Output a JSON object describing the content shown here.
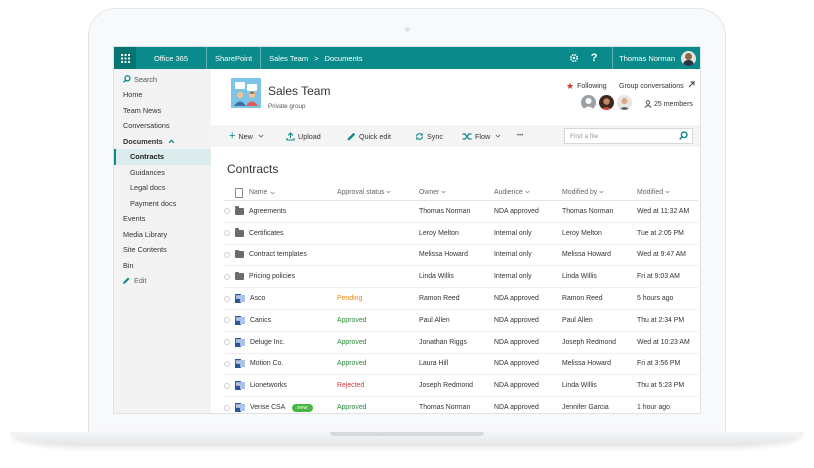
{
  "topbar": {
    "app": "Office 365",
    "product": "SharePoint",
    "breadcrumb_site": "Sales Team",
    "breadcrumb_sep": ">",
    "breadcrumb_lib": "Documents",
    "settings_icon": "gear-icon",
    "help": "?",
    "user": "Thomas Norman"
  },
  "leftnav": {
    "search": "Search",
    "items": [
      {
        "label": "Home"
      },
      {
        "label": "Team News"
      },
      {
        "label": "Conversations"
      },
      {
        "label": "Documents"
      },
      {
        "label": "Contracts"
      },
      {
        "label": "Guidances"
      },
      {
        "label": "Legal docs"
      },
      {
        "label": "Payment docs"
      },
      {
        "label": "Events"
      },
      {
        "label": "Media Library"
      },
      {
        "label": "Site Contents"
      },
      {
        "label": "Bin"
      },
      {
        "label": "Edit"
      }
    ]
  },
  "header": {
    "site_title": "Sales Team",
    "site_subtitle": "Private group",
    "following": "Following",
    "group_conversations": "Group conversations",
    "members": "25 members"
  },
  "commandbar": {
    "new": "New",
    "upload": "Upload",
    "quick_edit": "Quick edit",
    "sync": "Sync",
    "flow": "Flow",
    "more": "•••",
    "find_placeholder": "Find a file"
  },
  "library": {
    "title": "Contracts",
    "columns": [
      "Name",
      "Approval status",
      "Owner",
      "Audience",
      "Modified by",
      "Modified"
    ],
    "rows": [
      {
        "type": "folder",
        "name": "Agreements",
        "status": "",
        "owner": "Thomas Norman",
        "audience": "NDA approved",
        "modified_by": "Thomas Norman",
        "modified": "Wed at 11:32 AM"
      },
      {
        "type": "folder",
        "name": "Certificates",
        "status": "",
        "owner": "Leroy Melton",
        "audience": "Internal only",
        "modified_by": "Leroy Melton",
        "modified": "Tue at 2:05 PM"
      },
      {
        "type": "folder",
        "name": "Contract templates",
        "status": "",
        "owner": "Melissa Howard",
        "audience": "Internal only",
        "modified_by": "Melissa Howard",
        "modified": "Wed at 9:47 AM"
      },
      {
        "type": "folder",
        "name": "Pricing policies",
        "status": "",
        "owner": "Linda Willis",
        "audience": "Internal only",
        "modified_by": "Linda Willis",
        "modified": "Fri at 9:03 AM"
      },
      {
        "type": "word",
        "name": "Asco",
        "status": "Pending",
        "owner": "Ramon Reed",
        "audience": "NDA approved",
        "modified_by": "Ramon Reed",
        "modified": "5 hours ago"
      },
      {
        "type": "word",
        "name": "Canics",
        "status": "Approved",
        "owner": "Paul Allen",
        "audience": "NDA approved",
        "modified_by": "Paul Allen",
        "modified": "Thu at 2:34 PM"
      },
      {
        "type": "word",
        "name": "Deluge Inc.",
        "status": "Approved",
        "owner": "Jonathan Riggs",
        "audience": "NDA approved",
        "modified_by": "Joseph Redmond",
        "modified": "Wed at 10:23 AM"
      },
      {
        "type": "word",
        "name": "Motion Co.",
        "status": "Approved",
        "owner": "Laura Hill",
        "audience": "NDA approved",
        "modified_by": "Melissa Howard",
        "modified": "Fri at 3:56 PM"
      },
      {
        "type": "word",
        "name": "Lionetworks",
        "status": "Rejected",
        "owner": "Joseph Redmond",
        "audience": "NDA approved",
        "modified_by": "Linda Willis",
        "modified": "Thu at 5:23 PM"
      },
      {
        "type": "word",
        "name": "Verise CSA",
        "badge": "new",
        "status": "Approved",
        "owner": "Thomas Norman",
        "audience": "NDA approved",
        "modified_by": "Jennifer Garcia",
        "modified": "1 hour ago"
      }
    ]
  },
  "colors": {
    "accent": "#0a8a8a",
    "pending": "#e8880e",
    "approved": "#2a8a3a",
    "rejected": "#d13a36",
    "new_badge": "#4bb543"
  }
}
